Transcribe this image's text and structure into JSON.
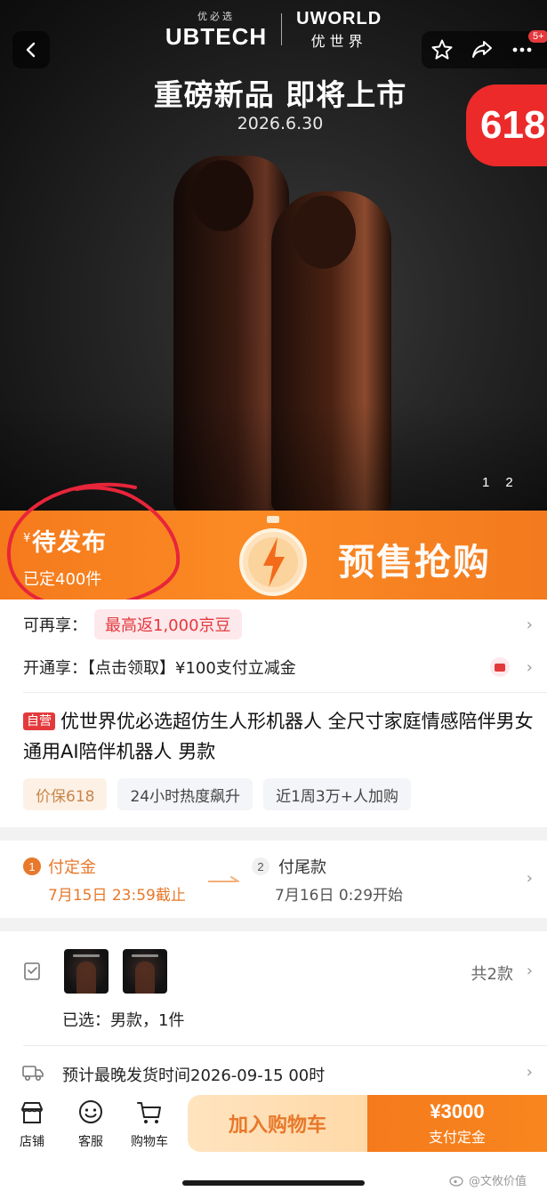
{
  "brand": {
    "left_small": "优必选",
    "left_name": "UBTECH",
    "right_name": "UWORLD",
    "right_cn": "优世界"
  },
  "hero": {
    "title": "重磅新品 即将上市",
    "date": "2026.6.30",
    "promo_badge": "618",
    "pager": [
      "1",
      "2"
    ],
    "message_count": "5+"
  },
  "presale": {
    "currency": "¥",
    "status": "待发布",
    "booked": "已定400件",
    "label": "预售抢购"
  },
  "benefits": {
    "row1_label": "可再享：",
    "row1_tag": "最高返1,000京豆",
    "row2_text": "开通享：【点击领取】¥100支付立减金"
  },
  "product": {
    "self_tag": "自营",
    "title": "优世界优必选超仿生人形机器人 全尺寸家庭情感陪伴男女通用AI陪伴机器人  男款",
    "chips": [
      "价保618",
      "24小时热度飙升",
      "近1周3万+人加购"
    ]
  },
  "payment_steps": {
    "step1_num": "1",
    "step1_title": "付定金",
    "step1_sub": "7月15日 23:59截止",
    "step2_num": "2",
    "step2_title": "付尾款",
    "step2_sub": "7月16日 0:29开始"
  },
  "variants": {
    "count": "共2款",
    "selected": "已选：男款，1件",
    "shipping": "预计最晚发货时间2026-09-15 00时"
  },
  "bottom_bar": {
    "shop": "店铺",
    "service": "客服",
    "cart": "购物车",
    "add_to_cart": "加入购物车",
    "deposit_amount": "¥3000",
    "deposit_label": "支付定金"
  },
  "watermark": "@文攸价值",
  "colors": {
    "accent_orange": "#f57a1c",
    "jd_red": "#e4393c",
    "deposit_text": "#e8782a"
  }
}
